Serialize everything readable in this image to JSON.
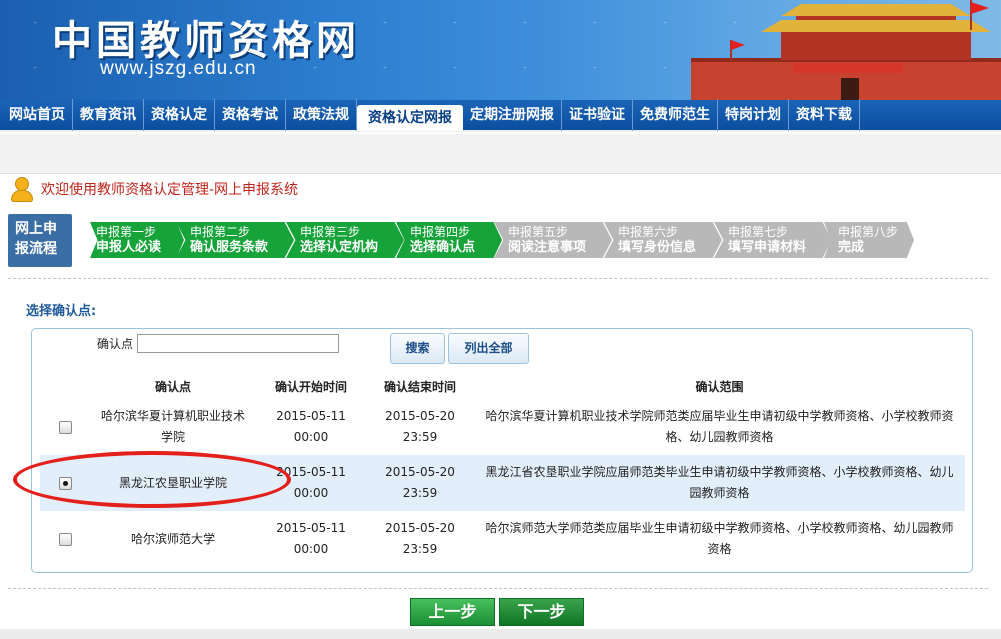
{
  "banner": {
    "title": "中国教师资格网",
    "url": "www.jszg.edu.cn",
    "image": "tiananmen-icon"
  },
  "nav": {
    "items": [
      "网站首页",
      "教育资讯",
      "资格认定",
      "资格考试",
      "政策法规",
      "资格认定网报",
      "定期注册网报",
      "证书验证",
      "免费师范生",
      "特岗计划",
      "资料下载"
    ],
    "active_index": 5
  },
  "welcome": {
    "icon": "user-icon",
    "text": "欢迎使用教师资格认定管理-网上申报系统"
  },
  "flow": {
    "label_line1": "网上申",
    "label_line2": "报流程",
    "steps": [
      {
        "l1": "申报第一步",
        "l2": "申报人必读",
        "state": "done"
      },
      {
        "l1": "申报第二步",
        "l2": "确认服务条款",
        "state": "done"
      },
      {
        "l1": "申报第三步",
        "l2": "选择认定机构",
        "state": "done"
      },
      {
        "l1": "申报第四步",
        "l2": "选择确认点",
        "state": "done"
      },
      {
        "l1": "申报第五步",
        "l2": "阅读注意事项",
        "state": "todo"
      },
      {
        "l1": "申报第六步",
        "l2": "填写身份信息",
        "state": "todo"
      },
      {
        "l1": "申报第七步",
        "l2": "填写申请材料",
        "state": "todo"
      },
      {
        "l1": "申报第八步",
        "l2": "完成",
        "state": "todo"
      }
    ],
    "colors": {
      "done": "#16a33a",
      "todo": "#b8b8b8"
    }
  },
  "section": {
    "title": "选择确认点:"
  },
  "search": {
    "label": "确认点",
    "value": "",
    "search_button": "搜索",
    "list_all_button": "列出全部"
  },
  "table": {
    "headers": [
      "",
      "确认点",
      "确认开始时间",
      "确认结束时间",
      "确认范围"
    ],
    "rows": [
      {
        "selected": false,
        "name": "哈尔滨华夏计算机职业技术学院",
        "start_date": "2015-05-11",
        "start_time": "00:00",
        "end_date": "2015-05-20",
        "end_time": "23:59",
        "scope": "哈尔滨华夏计算机职业技术学院师范类应届毕业生申请初级中学教师资格、小学校教师资格、幼儿园教师资格"
      },
      {
        "selected": true,
        "name": "黑龙江农垦职业学院",
        "start_date": "2015-05-11",
        "start_time": "00:00",
        "end_date": "2015-05-20",
        "end_time": "23:59",
        "scope": "黑龙江省农垦职业学院应届师范类毕业生申请初级中学教师资格、小学校教师资格、幼儿园教师资格"
      },
      {
        "selected": false,
        "name": "哈尔滨师范大学",
        "start_date": "2015-05-11",
        "start_time": "00:00",
        "end_date": "2015-05-20",
        "end_time": "23:59",
        "scope": "哈尔滨师范大学师范类应届毕业生申请初级中学教师资格、小学校教师资格、幼儿园教师资格"
      }
    ]
  },
  "footer": {
    "prev_button": "上一步",
    "next_button": "下一步"
  }
}
